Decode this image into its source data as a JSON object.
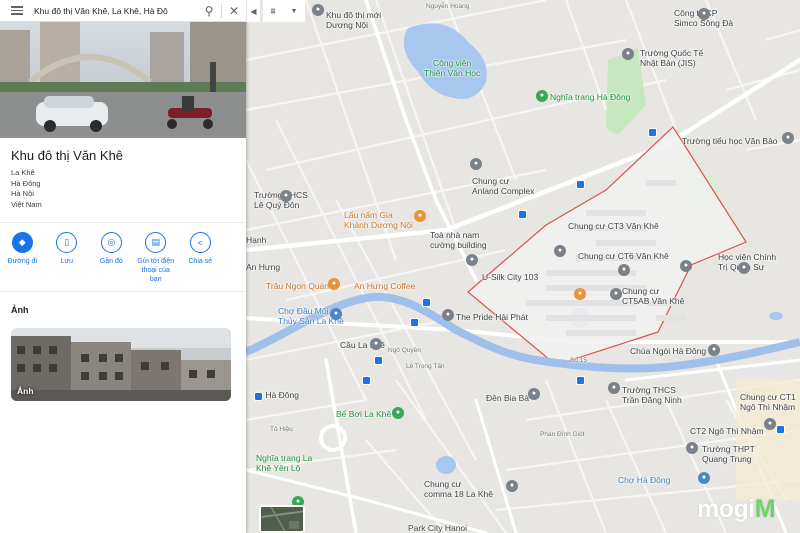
{
  "search": {
    "query": "Khu đô thị Văn Khê, La Khê, Hà Đô"
  },
  "place": {
    "title": "Khu đô thị Văn Khê",
    "address_lines": [
      "La Khê",
      "Hà Đông",
      "Hà Nội",
      "Việt Nam"
    ]
  },
  "actions": [
    {
      "label": "Đường đi",
      "icon": "directions-icon"
    },
    {
      "label": "Lưu",
      "icon": "bookmark-icon"
    },
    {
      "label": "Gần đó",
      "icon": "nearby-icon"
    },
    {
      "label": "Gửi tới điện thoại của bạn",
      "icon": "send-to-phone-icon"
    },
    {
      "label": "Chia sẻ",
      "icon": "share-icon"
    }
  ],
  "photos": {
    "heading": "Ảnh",
    "tile_label": "Ảnh"
  },
  "map_labels": {
    "do_thi_moi": "Khu đô thị mới\nDương Nội",
    "cong_vien": "Công viên\nThiên Văn Học",
    "simco": "Công ty CP\nSimco Sông Đà",
    "truong_qt": "Trường Quốc Tế\nNhật Bản (JIS)",
    "nghia_trang_hd": "Nghĩa trang Hà Đông",
    "th_van_bao": "Trường tiểu học Văn Bảo",
    "thcs_quy_don": "Trường THCS\nLê Quý Đôn",
    "anland": "Chung cư\nAnland Complex",
    "lau_nam": "Lẩu nấm Gia\nKhánh Dương Nội",
    "toa_nha": "Toà nhà nam\ncường building",
    "ct3": "Chung cư CT3 Văn Khê",
    "ct6": "Chung cư CT6 Văn Khê",
    "hoc_vien": "Học viện Chính\nTrị Quân Sự",
    "usilk": "U-Silk City 103",
    "ct5ab": "Chung cư\nCT5AB Văn Khê",
    "hanh": "Hạnh",
    "an_hung": "An Hưng",
    "trau_ngon": "Trâu Ngon Quán",
    "an_hung_coffee": "An Hưng Coffee",
    "cho_dau_moi": "Chợ Đầu Mối\nThủy Sản La Khê",
    "pride": "The Pride Hải Phát",
    "cau_la_khe": "Cầu La Khê",
    "chua_ngoi": "Chùa Ngòi Hà Đông",
    "thcs_tran_dang_ninh": "Trường THCS\nTrần Đăng Ninh",
    "ct1": "Chung cư CT1\nNgô Thì Nhậm",
    "den_bia": "Đền Bia Bà",
    "mha_dong": "M Hà Đông",
    "be_boi": "Bể Bơi La Khê",
    "ct2": "CT2 Ngô Thì Nhậm",
    "thpt_quang_trung": "Trường THPT\nQuang Trung",
    "nghia_trang_la_khe": "Nghĩa trang La\nKhê Yên Lộ",
    "cho_ha_dong": "Chợ Hà Đông",
    "comma": "Chung cư\ncomma 18 La Khê",
    "park_city": "Park City Hanoi",
    "rd_ngo_quyen": "Ngô Quyền",
    "rd_le_trong_tan": "Lê Trọng Tấn",
    "rd_to_hieu": "Tô Hiệu",
    "rd_phan_dinh_giot": "Phan Đình Giót",
    "rd_so15": "Số 15",
    "rd_nguyen_hoang": "Nguyễn Hoàng"
  },
  "watermark": {
    "text_a": "mogi",
    "text_b": "M"
  },
  "colors": {
    "accent": "#1a73e8",
    "boundary": "#d9534f",
    "water": "#a8c7ee",
    "park": "#c6e7c0"
  }
}
